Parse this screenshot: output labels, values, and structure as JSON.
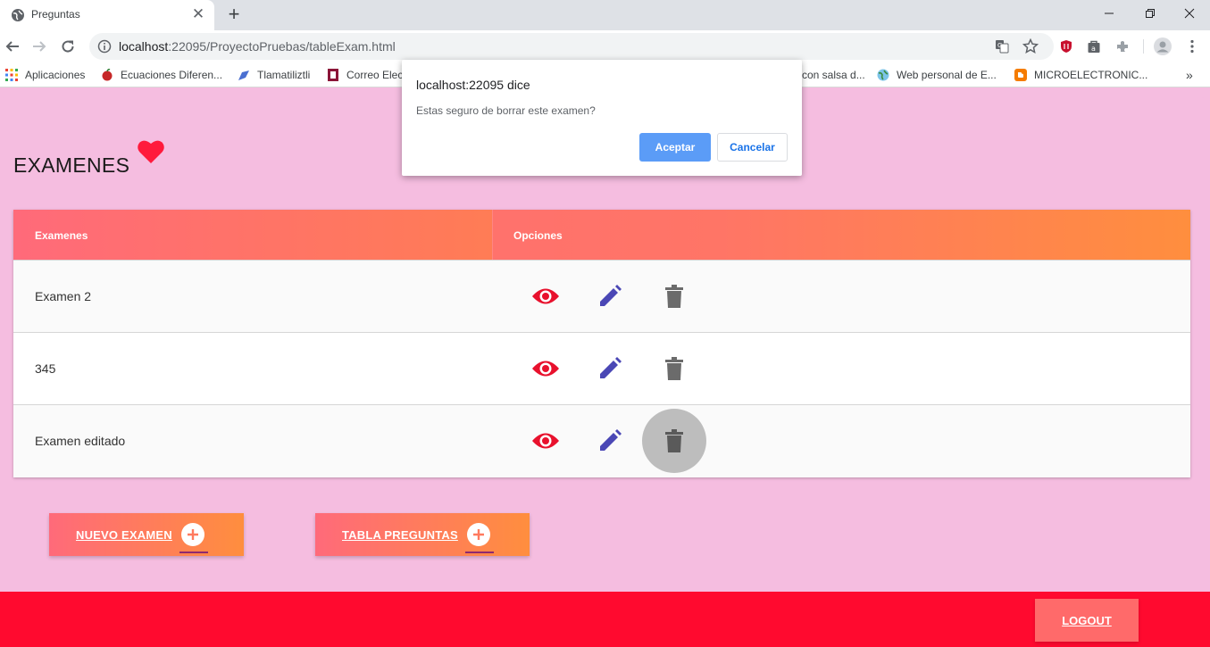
{
  "browser": {
    "tab_title": "Preguntas",
    "url_host": "localhost",
    "url_path": ":22095/ProyectoPruebas/tableExam.html",
    "bookmarks": [
      {
        "label": "Aplicaciones",
        "icon": "apps-grid-icon"
      },
      {
        "label": "Ecuaciones Diferen...",
        "icon": "apple-icon"
      },
      {
        "label": "Tlamatiliztli",
        "icon": "feather-icon"
      },
      {
        "label": "Correo Elec",
        "icon": "ipn-logo-icon"
      },
      {
        "label": "con salsa d...",
        "icon": ""
      },
      {
        "label": "Web personal de E...",
        "icon": "globe-icon"
      },
      {
        "label": "MICROELECTRONIC...",
        "icon": "blogger-icon"
      }
    ],
    "bookmarks_overflow": "»"
  },
  "page": {
    "title": "EXAMENES",
    "table": {
      "headers": [
        "Examenes",
        "Opciones"
      ],
      "rows": [
        {
          "name": "Examen 2"
        },
        {
          "name": "345"
        },
        {
          "name": "Examen editado"
        }
      ]
    },
    "buttons": {
      "new_exam": "NUEVO EXAMEN",
      "questions_table": "TABLA PREGUNTAS",
      "logout": "LOGOUT"
    }
  },
  "dialog": {
    "title": "localhost:22095 dice",
    "message": "Estas seguro de borrar este examen?",
    "ok": "Aceptar",
    "cancel": "Cancelar"
  },
  "colors": {
    "page_bg": "#f5bde0",
    "header_gradient_start": "#ff6a7a",
    "header_gradient_end": "#ff8e3e",
    "footer": "#ff0a2f",
    "view_icon": "#e8112d",
    "edit_icon": "#4a47b5",
    "delete_icon": "#6b6b6b",
    "dialog_ok": "#5b9cf7"
  }
}
